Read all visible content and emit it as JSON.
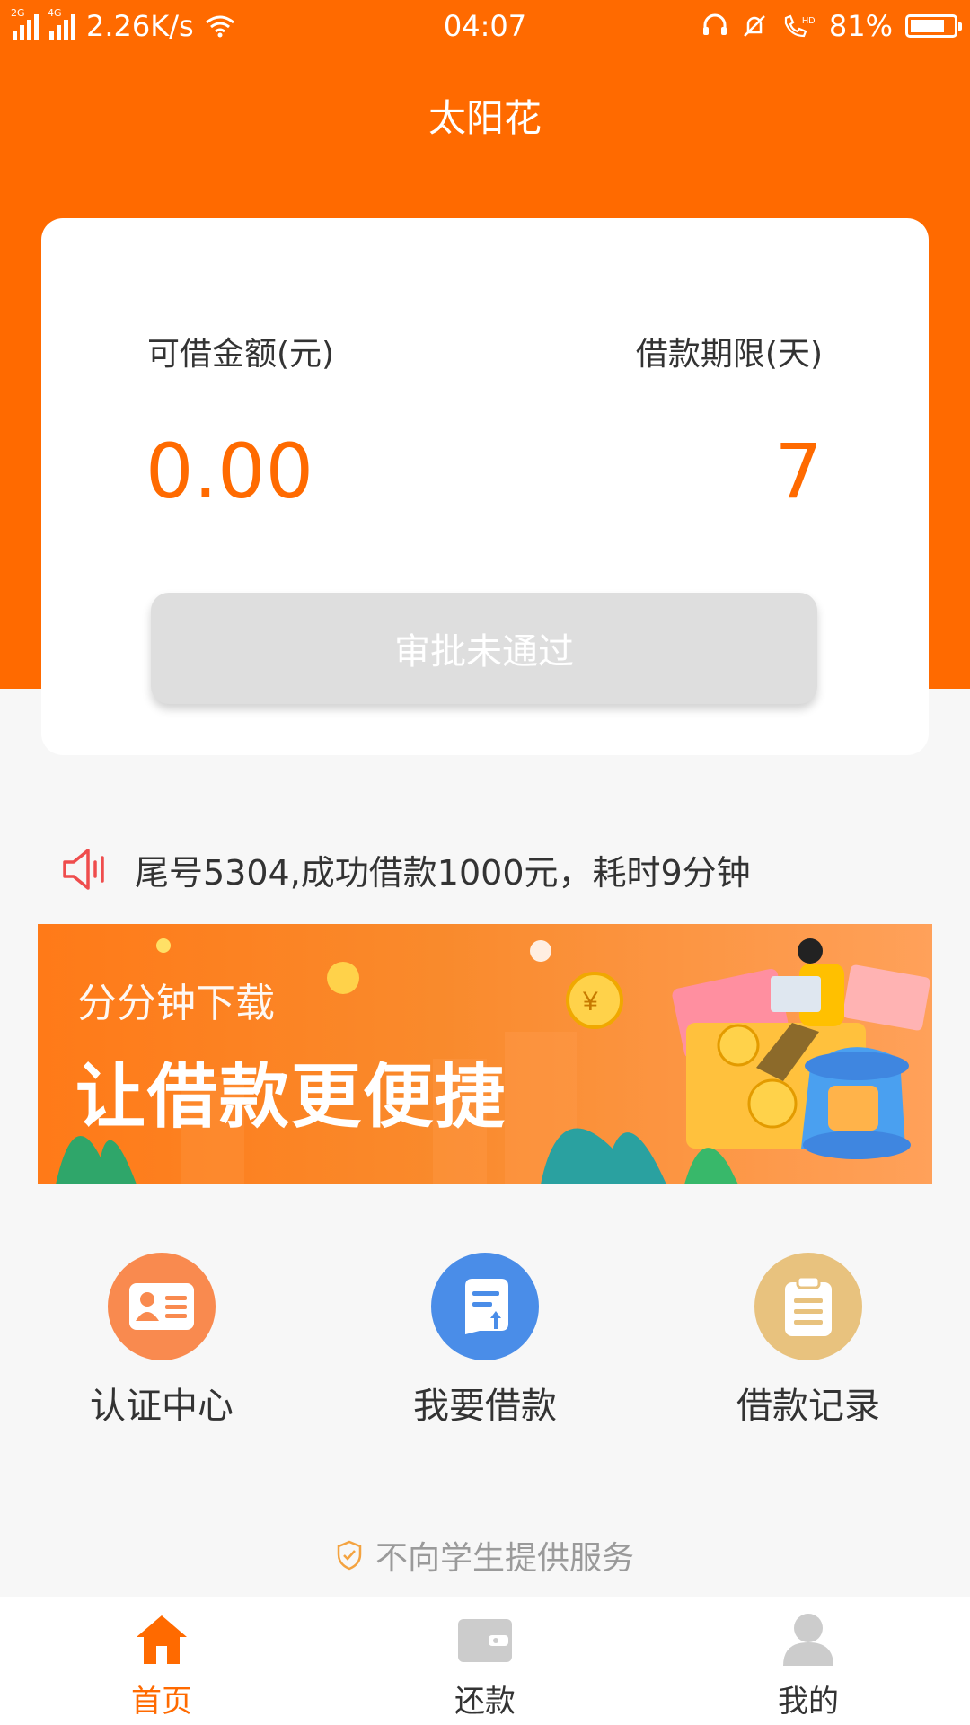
{
  "status_bar": {
    "network_speed": "2.26K/s",
    "signal_2g_label": "2G",
    "signal_4g_label": "4G",
    "time": "04:07",
    "battery_percent": "81%",
    "battery_level": 0.81,
    "hd_label": "HD"
  },
  "header": {
    "title": "太阳花"
  },
  "loan_card": {
    "amount_label": "可借金额(元)",
    "amount_value": "0.00",
    "term_label": "借款期限(天)",
    "term_value": "7",
    "status_button": "审批未通过"
  },
  "notice": {
    "text": "尾号5304,成功借款1000元，耗时9分钟"
  },
  "banner": {
    "subtitle": "分分钟下载",
    "headline": "让借款更便捷"
  },
  "actions": [
    {
      "label": "认证中心",
      "icon": "id-card-icon",
      "color": "#f98a4f"
    },
    {
      "label": "我要借款",
      "icon": "loan-form-icon",
      "color": "#4a8de8"
    },
    {
      "label": "借款记录",
      "icon": "clipboard-icon",
      "color": "#e8c27e"
    }
  ],
  "disclaimer": {
    "text": "不向学生提供服务"
  },
  "tab_bar": {
    "items": [
      {
        "label": "首页",
        "icon": "home-icon",
        "active": true
      },
      {
        "label": "还款",
        "icon": "wallet-icon",
        "active": false
      },
      {
        "label": "我的",
        "icon": "user-icon",
        "active": false
      }
    ]
  },
  "colors": {
    "brand": "#ff6a00",
    "active_tab": "#ff6a00",
    "inactive_tab": "#333333",
    "inactive_icon": "#cccccc"
  }
}
